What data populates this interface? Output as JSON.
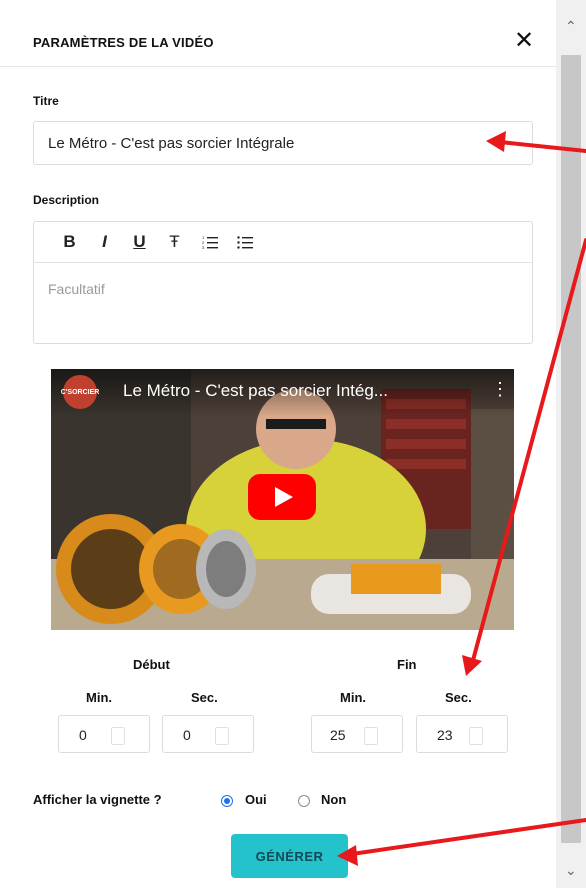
{
  "panel": {
    "title": "PARAMÈTRES DE LA VIDÉO",
    "close_label": "✕"
  },
  "fields": {
    "title_label": "Titre",
    "title_value": "Le Métro - C'est pas sorcier Intégrale",
    "description_label": "Description",
    "description_placeholder": "Facultatif"
  },
  "toolbar": {
    "bold": "B",
    "italic": "I",
    "underline": "U",
    "strike": "Ŧ",
    "ordered_list": "☰",
    "bullet_list": "☰"
  },
  "video": {
    "channel_logo_text": "C'SORCIER",
    "title": "Le Métro - C'est pas sorcier Intég...",
    "menu_label": "⋮",
    "accent_color": "#ff0000"
  },
  "timing": {
    "start_label": "Début",
    "end_label": "Fin",
    "min_label": "Min.",
    "sec_label": "Sec.",
    "start_min": "0",
    "start_sec": "0",
    "end_min": "25",
    "end_sec": "23"
  },
  "thumbnail_option": {
    "label": "Afficher la vignette ?",
    "yes_label": "Oui",
    "no_label": "Non",
    "selected": "Oui"
  },
  "actions": {
    "generate_label": "GÉNÉRER"
  },
  "colors": {
    "button_bg": "#24c2ca",
    "annotation_arrow": "#e8191b",
    "radio_selected": "#1a73e8"
  },
  "icons": {
    "scroll_up": "chevron-up-icon",
    "scroll_down": "chevron-down-icon",
    "play": "play-icon"
  }
}
